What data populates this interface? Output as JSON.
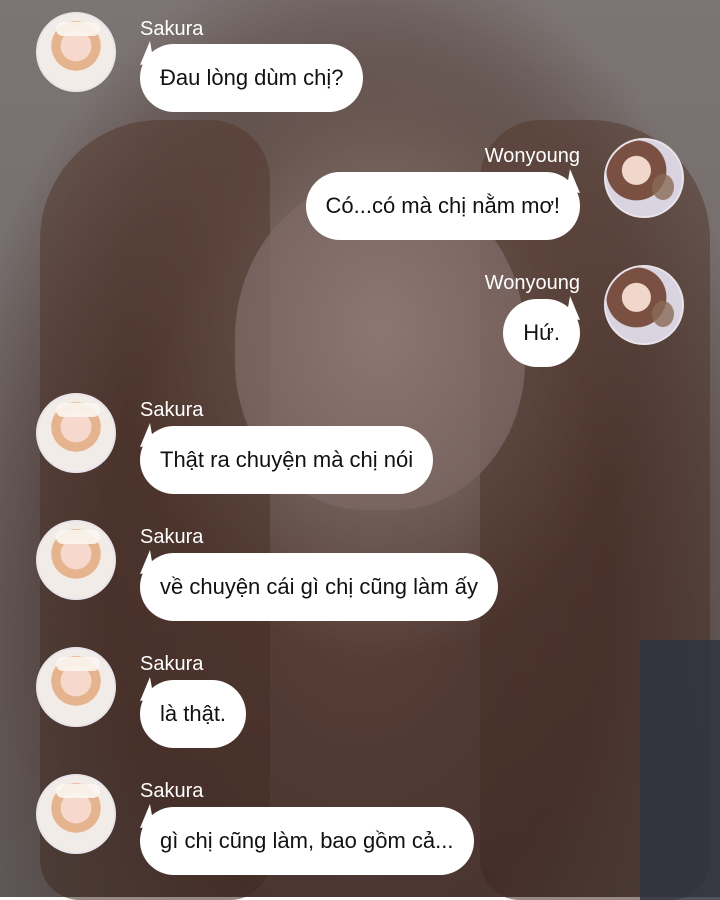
{
  "messages": [
    {
      "sender": "Sakura",
      "text": "Đau lòng dùm chị?"
    },
    {
      "sender": "Wonyoung",
      "text": "Có...có mà chị nằm mơ!"
    },
    {
      "sender": "Wonyoung",
      "text": "Hứ."
    },
    {
      "sender": "Sakura",
      "text": "Thật ra chuyện mà chị nói"
    },
    {
      "sender": "Sakura",
      "text": "về chuyện cái gì chị cũng làm ấy"
    },
    {
      "sender": "Sakura",
      "text": "là thật."
    },
    {
      "sender": "Sakura",
      "text": "gì chị cũng làm, bao gồm cả..."
    }
  ]
}
